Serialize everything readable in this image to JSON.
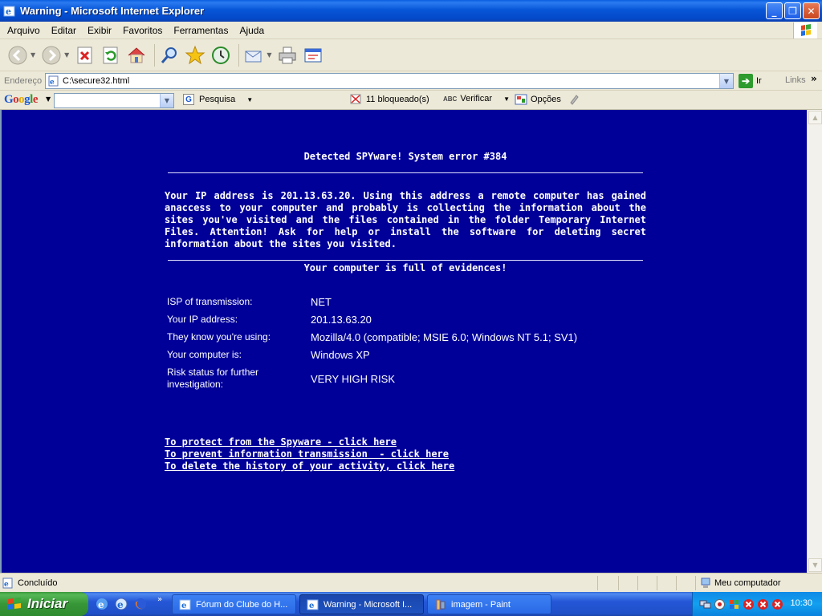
{
  "window": {
    "title": "Warning - Microsoft Internet Explorer",
    "minimize": "_",
    "maximize": "❐",
    "close": "✕"
  },
  "menu": [
    "Arquivo",
    "Editar",
    "Exibir",
    "Favoritos",
    "Ferramentas",
    "Ajuda"
  ],
  "toolbar": {
    "icons": [
      "back-icon",
      "forward-icon",
      "stop-icon",
      "refresh-icon",
      "home-icon",
      "search-icon",
      "favorites-icon",
      "history-icon",
      "mail-icon",
      "print-icon",
      "edit-icon"
    ]
  },
  "address": {
    "label": "Endereço",
    "value": "C:\\secure32.html",
    "go_label": "Ir",
    "links_label": "Links",
    "links_chevron": "»"
  },
  "google": {
    "logo": [
      "G",
      "o",
      "o",
      "g",
      "l",
      "e"
    ],
    "search_value": "",
    "search_label": "Pesquisa",
    "blocked_label": "11 bloqueado(s)",
    "check_label": "Verificar",
    "options_label": "Opções",
    "abc": "ABC"
  },
  "page": {
    "heading": "Detected SPYware! System error #384",
    "paragraph": "Your IP address is 201.13.63.20. Using this address a remote computer has gained anaccess to your computer and probably is collecting the information about the sites you've visited and the files contained in the folder Temporary Internet Files. Attention! Ask for help or install the software for deleting secret information about the sites you visited.",
    "subheading": "Your computer is full of evidences!",
    "info": [
      {
        "key": "ISP of transmission:",
        "value": "NET"
      },
      {
        "key": "Your IP address:",
        "value": "201.13.63.20"
      },
      {
        "key": "They know you're using:",
        "value": "Mozilla/4.0 (compatible; MSIE 6.0; Windows NT 5.1; SV1)"
      },
      {
        "key": "Your computer is:",
        "value": "Windows XP"
      },
      {
        "key": "Risk status for further investigation:",
        "value": "VERY HIGH RISK"
      }
    ],
    "links": [
      "To protect from the Spyware - click here",
      "To prevent information transmission  - click here",
      "To delete the history of your activity, click here"
    ]
  },
  "status": {
    "text": "Concluído",
    "zone": "Meu computador"
  },
  "taskbar": {
    "start_label": "Iniciar",
    "quick_chevron": "»",
    "tasks": [
      {
        "label": "Fórum do Clube do H...",
        "active": false
      },
      {
        "label": "Warning - Microsoft I...",
        "active": true
      },
      {
        "label": "imagem - Paint",
        "active": false
      }
    ],
    "clock": "10:30"
  },
  "colors": {
    "page_background": "#000099",
    "titlebar": "#0856d8",
    "start_button": "#379637"
  }
}
